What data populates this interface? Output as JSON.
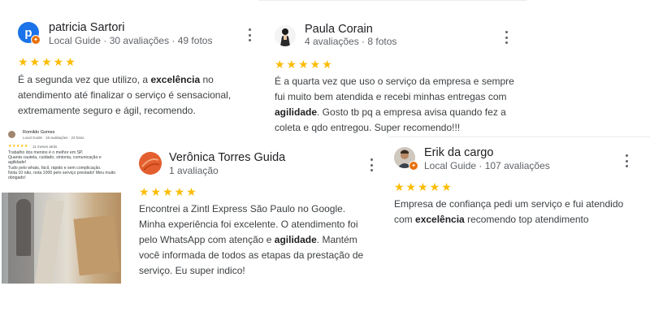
{
  "reviews": [
    {
      "name": "patricia Sartori",
      "meta": "Local Guide · 30 avaliações · 49 fotos",
      "avatar_letter": "p",
      "stars": "★★★★★",
      "text_parts": [
        {
          "t": "É a segunda vez que utilizo, a "
        },
        {
          "t": "excelência",
          "b": true
        },
        {
          "t": " no atendimento até finalizar o serviço é sensacional, extremamente seguro e ágil,  recomendo."
        }
      ]
    },
    {
      "name": "Paula Corain",
      "meta": "4 avaliações · 8 fotos",
      "stars": "★★★★★",
      "text_parts": [
        {
          "t": "É a quarta vez que uso o serviço da empresa e sempre fui muito bem atendida e recebi minhas entregas com "
        },
        {
          "t": "agilidade",
          "b": true
        },
        {
          "t": ". Gosto tb pq a empresa avisa quando fez a coleta e qdo entregou. Super recomendo!!!"
        }
      ]
    },
    {
      "name": "Verônica Torres Guida",
      "meta": "1 avaliação",
      "stars": "★★★★★",
      "text_parts": [
        {
          "t": "Encontrei a Zintl Express São Paulo no Google. Minha experiência foi excelente. O atendimento foi pelo WhatsApp com  atenção e "
        },
        {
          "t": "agilidade",
          "b": true
        },
        {
          "t": ". Mantém você informada de todos as etapas da prestação de serviço. Eu super indico!"
        }
      ]
    },
    {
      "name": "Erik da cargo",
      "meta": "Local Guide · 107 avaliações",
      "stars": "★★★★★",
      "text_parts": [
        {
          "t": "Empresa de confiança pedi um serviço e fui atendido com "
        },
        {
          "t": "excelência",
          "b": true
        },
        {
          "t": " recomendo top atendimento"
        }
      ]
    }
  ],
  "mini_review": {
    "name": "Romildo Gomes",
    "meta": "Local Guide · 18 avaliações · 23 fotos",
    "stars": "★★★★★",
    "when": "11 meses atrás",
    "lines": [
      "Trabalho dos menino é o melhor em SP.",
      "Quanta cautela, cuidado, sintonia, comunicação e agilidade!",
      "Tudo pelo whats, fácil, rápido e sem complicação.",
      "Nota 10 não, nota 1000 pelo serviço prestado! Meu muito obrigado!"
    ]
  },
  "colors": {
    "star": "#fbbc04",
    "badge": "#e8710a",
    "avatar_patricia": "#1a73e8",
    "avatar_veronica": "#e8663d"
  },
  "icons": [
    "kebab-menu-icon",
    "local-guide-badge-icon",
    "star-icon"
  ]
}
